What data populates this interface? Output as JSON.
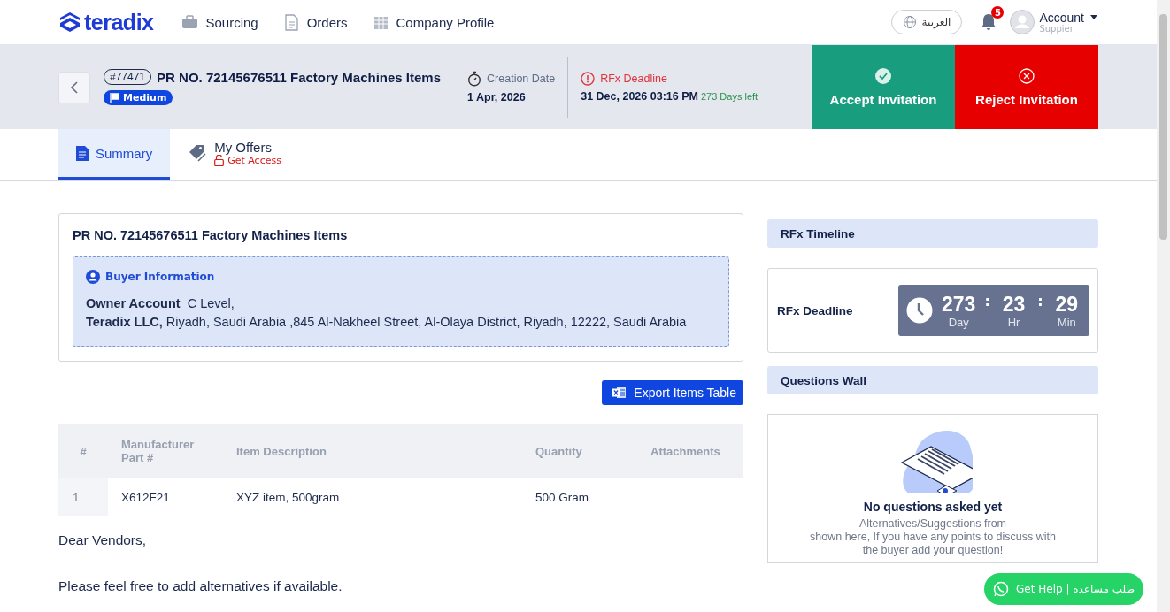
{
  "nav": {
    "logo": "teradix",
    "items": [
      {
        "label": "Sourcing"
      },
      {
        "label": "Orders"
      },
      {
        "label": "Company Profile"
      }
    ],
    "language": "العربية",
    "notifications": "5",
    "account": {
      "name": "Account",
      "role": "Suppier"
    }
  },
  "header": {
    "id": "#77471",
    "title": "PR NO. 72145676511 Factory Machines Items",
    "priority": "Medium",
    "creation_label": "Creation Date",
    "creation_date": "1 Apr, 2026",
    "deadline_label": "RFx Deadline",
    "deadline": "31 Dec, 2026 03:16 PM",
    "days_left": "273 Days left",
    "buttons": [
      {
        "label": "Accept Invitation",
        "kind": "accept"
      },
      {
        "label": "Reject Invitation",
        "kind": "reject"
      }
    ]
  },
  "tabs": [
    {
      "label": "Summary",
      "selected": true
    },
    {
      "label": "My Offers",
      "note": "Get Access",
      "selected": false
    }
  ],
  "summary": {
    "title": "PR NO. 72145676511 Factory Machines Items",
    "buyer_heading": "Buyer Information",
    "owner_label": "Owner Account",
    "owner_value": "C Level,",
    "company": "Teradix LLC,",
    "address": "Riyadh, Saudi Arabia ,845 Al-Nakheel Street, Al-Olaya District, Riyadh, 12222, Saudi Arabia"
  },
  "export_button": "Export Items Table",
  "table": {
    "columns": [
      "#",
      "Manufacturer Part #",
      "Item Description",
      "Quantity",
      "Attachments"
    ],
    "rows": [
      [
        "1",
        "X612F21",
        "XYZ item, 500gram",
        "500 Gram",
        ""
      ]
    ]
  },
  "message": [
    "Dear Vendors,",
    "Please feel free to add alternatives if available."
  ],
  "timeline": {
    "heading": "RFx Timeline",
    "label": "RFx Deadline",
    "units": [
      {
        "value": "273",
        "unit": "Day"
      },
      {
        "value": "23",
        "unit": "Hr"
      },
      {
        "value": "29",
        "unit": "Min"
      }
    ],
    "separator": ":"
  },
  "questions": {
    "heading": "Questions Wall",
    "empty_title": "No questions asked yet",
    "empty_lines": [
      "Alternatives/Suggestions from",
      "shown here, If you have any points to discuss with",
      "the buyer add your question!"
    ]
  },
  "help_button": "Get Help | طلب مساعده"
}
